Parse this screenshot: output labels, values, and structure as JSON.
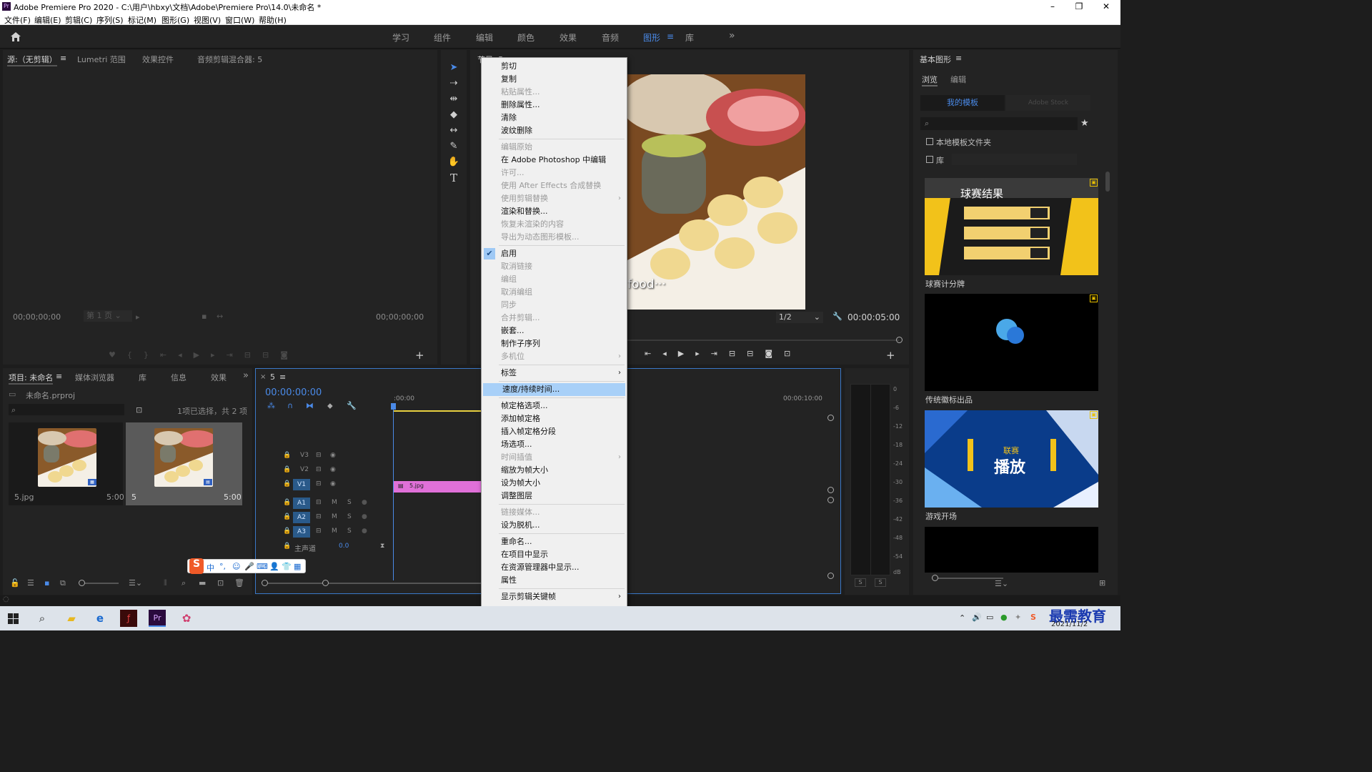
{
  "window": {
    "app_icon": "Pr",
    "title": "Adobe Premiere Pro 2020 - C:\\用户\\hbxy\\文档\\Adobe\\Premiere Pro\\14.0\\未命名 *",
    "minimize": "–",
    "restore": "❐",
    "close": "✕"
  },
  "menu": [
    "文件(F)",
    "编辑(E)",
    "剪辑(C)",
    "序列(S)",
    "标记(M)",
    "图形(G)",
    "视图(V)",
    "窗口(W)",
    "帮助(H)"
  ],
  "workspaces": [
    "学习",
    "组件",
    "编辑",
    "颜色",
    "效果",
    "音频",
    "图形",
    "库"
  ],
  "active_workspace": "图形",
  "ws_menu_glyph": "≡",
  "ws_more_glyph": "»",
  "source_panel": {
    "tabs": [
      "源:（无剪辑）",
      "Lumetri 范围",
      "效果控件",
      "音频剪辑混合器: 5"
    ],
    "tab_menu_glyph": "≡",
    "timecode_left": "00;00;00;00",
    "page_label": "第 1 页",
    "timecode_right": "00;00;00;00",
    "add_glyph": "+"
  },
  "program_panel": {
    "tab_label": "节目: 5",
    "overlay_text": "food···",
    "zoom": "1/2",
    "timecode": "00:00:05:00",
    "add_glyph": "+"
  },
  "project_panel": {
    "tabs": [
      "项目: 未命名",
      "媒体浏览器",
      "库",
      "信息",
      "效果"
    ],
    "more_glyph": "»",
    "file_name": "未命名.prproj",
    "selection_info": "1项已选择，共 2 项",
    "items": [
      {
        "name": "5.jpg",
        "duration": "5:00"
      },
      {
        "name": "5",
        "duration": "5:00"
      }
    ]
  },
  "timeline": {
    "tab": "5",
    "tab_close": "×",
    "timecode": "00:00:00:00",
    "ruler_start": ":00:00",
    "ruler_end": "00:00:10:00",
    "video_tracks": [
      "V3",
      "V2",
      "V1"
    ],
    "audio_tracks": [
      "A1",
      "A2",
      "A3"
    ],
    "master_label": "主声道",
    "master_value": "0.0",
    "track_m": "M",
    "track_s": "S",
    "clip_name": "5.jpg"
  },
  "audio_meter": {
    "scale": [
      "0",
      "-6",
      "-12",
      "-18",
      "-24",
      "-30",
      "-36",
      "-42",
      "-48",
      "-54",
      "dB"
    ],
    "solo": [
      "S",
      "S"
    ]
  },
  "essential_graphics": {
    "title": "基本图形",
    "menu_glyph": "≡",
    "tabs": [
      "浏览",
      "编辑"
    ],
    "source_buttons": [
      "我的模板",
      "Adobe Stock"
    ],
    "local_templates": "本地模板文件夹",
    "library_label": "库",
    "templates": [
      "球赛计分牌",
      "传统徽标出品",
      "游戏开场"
    ],
    "template1_text": "球赛结果",
    "template3_text_top": "联赛",
    "template3_text_main": "播放"
  },
  "context_menu": [
    {
      "label": "剪切",
      "disabled": false
    },
    {
      "label": "复制",
      "disabled": false
    },
    {
      "label": "粘贴属性...",
      "disabled": true
    },
    {
      "label": "删除属性...",
      "disabled": false
    },
    {
      "label": "清除",
      "disabled": false
    },
    {
      "label": "波纹删除",
      "disabled": false
    },
    {
      "separator": true
    },
    {
      "label": "编辑原始",
      "disabled": true
    },
    {
      "label": "在 Adobe Photoshop 中编辑",
      "disabled": false
    },
    {
      "label": "许可...",
      "disabled": true
    },
    {
      "label": "使用 After Effects 合成替换",
      "disabled": true
    },
    {
      "label": "使用剪辑替换",
      "disabled": true,
      "submenu": true
    },
    {
      "label": "渲染和替换...",
      "disabled": false
    },
    {
      "label": "恢复未渲染的内容",
      "disabled": true
    },
    {
      "label": "导出为动态图形模板...",
      "disabled": true
    },
    {
      "separator": true
    },
    {
      "label": "启用",
      "disabled": false,
      "checked": true
    },
    {
      "label": "取消链接",
      "disabled": true
    },
    {
      "label": "编组",
      "disabled": true
    },
    {
      "label": "取消编组",
      "disabled": true
    },
    {
      "label": "同步",
      "disabled": true
    },
    {
      "label": "合并剪辑...",
      "disabled": true
    },
    {
      "label": "嵌套...",
      "disabled": false
    },
    {
      "label": "制作子序列",
      "disabled": false
    },
    {
      "label": "多机位",
      "disabled": true,
      "submenu": true
    },
    {
      "separator": true
    },
    {
      "label": "标签",
      "disabled": false,
      "submenu": true
    },
    {
      "separator": true
    },
    {
      "label": "速度/持续时间...",
      "disabled": false,
      "highlighted": true
    },
    {
      "separator": true
    },
    {
      "label": "帧定格选项...",
      "disabled": false
    },
    {
      "label": "添加帧定格",
      "disabled": false
    },
    {
      "label": "插入帧定格分段",
      "disabled": false
    },
    {
      "label": "场选项...",
      "disabled": false
    },
    {
      "label": "时间插值",
      "disabled": true,
      "submenu": true
    },
    {
      "label": "缩放为帧大小",
      "disabled": false
    },
    {
      "label": "设为帧大小",
      "disabled": false
    },
    {
      "label": "调整图层",
      "disabled": false
    },
    {
      "separator": true
    },
    {
      "label": "链接媒体...",
      "disabled": true
    },
    {
      "label": "设为脱机...",
      "disabled": false
    },
    {
      "separator": true
    },
    {
      "label": "重命名...",
      "disabled": false
    },
    {
      "label": "在项目中显示",
      "disabled": false
    },
    {
      "label": "在资源管理器中显示...",
      "disabled": false
    },
    {
      "label": "属性",
      "disabled": false
    },
    {
      "separator": true
    },
    {
      "label": "显示剪辑关键帧",
      "disabled": false,
      "submenu": true
    }
  ],
  "ime_bar": [
    "S",
    "中",
    "°,",
    "☺",
    "🎤",
    "⌨",
    "👤",
    "👕",
    "▦"
  ],
  "taskbar": {
    "date": "2021/11/2",
    "watermark": "最需教育"
  }
}
